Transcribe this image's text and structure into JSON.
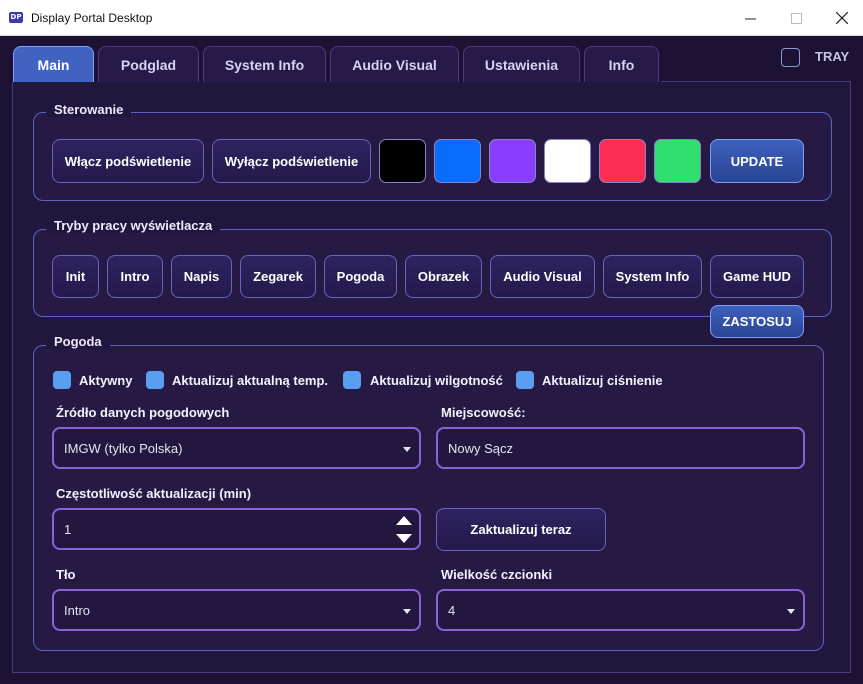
{
  "window": {
    "title": "Display Portal Desktop",
    "icon_text": "DP",
    "minimize_icon": "minimize-icon",
    "maximize_icon": "maximize-icon",
    "close_icon": "close-icon"
  },
  "tabs": [
    {
      "label": "Main",
      "active": true
    },
    {
      "label": "Podglad",
      "active": false
    },
    {
      "label": "System Info",
      "active": false
    },
    {
      "label": "Audio Visual",
      "active": false
    },
    {
      "label": "Ustawienia",
      "active": false
    },
    {
      "label": "Info",
      "active": false
    }
  ],
  "tray": {
    "label": "TRAY",
    "checked": false
  },
  "sterowanie": {
    "title": "Sterowanie",
    "on_label": "Włącz podświetlenie",
    "off_label": "Wyłącz podświetlenie",
    "colors": [
      "#000000",
      "#0a6cff",
      "#8a3dff",
      "#ffffff",
      "#ff2d55",
      "#2fe06f"
    ],
    "update_label": "UPDATE"
  },
  "tryby": {
    "title": "Tryby pracy wyświetlacza",
    "modes": [
      "Init",
      "Intro",
      "Napis",
      "Zegarek",
      "Pogoda",
      "Obrazek",
      "Audio Visual",
      "System Info",
      "Game HUD"
    ],
    "apply_label": "ZASTOSUJ"
  },
  "pogoda": {
    "title": "Pogoda",
    "checkboxes": [
      {
        "label": "Aktywny",
        "checked": true
      },
      {
        "label": "Aktualizuj aktualną temp.",
        "checked": true
      },
      {
        "label": "Aktualizuj wilgotność",
        "checked": true
      },
      {
        "label": "Aktualizuj ciśnienie",
        "checked": true
      }
    ],
    "source_label": "Źródło danych pogodowych",
    "source_value": "IMGW (tylko Polska)",
    "city_label": "Miejscowość:",
    "city_value": "Nowy Sącz",
    "freq_label": "Częstotliwość aktualizacji (min)",
    "freq_value": "1",
    "update_now_label": "Zaktualizuj teraz",
    "bg_label": "Tło",
    "bg_value": "Intro",
    "font_size_label": "Wielkość czcionki",
    "font_size_value": "4"
  },
  "colors": {
    "accent": "#3f63bf",
    "checkbox": "#5a9ef2",
    "field_border": "#8a62d8"
  }
}
